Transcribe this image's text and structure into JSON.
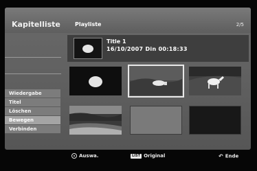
{
  "header": {
    "title": "Kapitelliste",
    "subtitle": "Playliste",
    "page": "2/5"
  },
  "info": {
    "title": "Title 1",
    "meta": "16/10/2007  Din  00:18:33"
  },
  "menu": {
    "items": [
      {
        "label": "Wiedergabe"
      },
      {
        "label": "Titel"
      },
      {
        "label": "Löschen"
      },
      {
        "label": "Bewegen",
        "active": true
      },
      {
        "label": "Verbinden"
      }
    ]
  },
  "footer": {
    "select_label": "Auswa.",
    "list_badge": "LIST",
    "original_label": "Original",
    "end_label": "Ende"
  }
}
